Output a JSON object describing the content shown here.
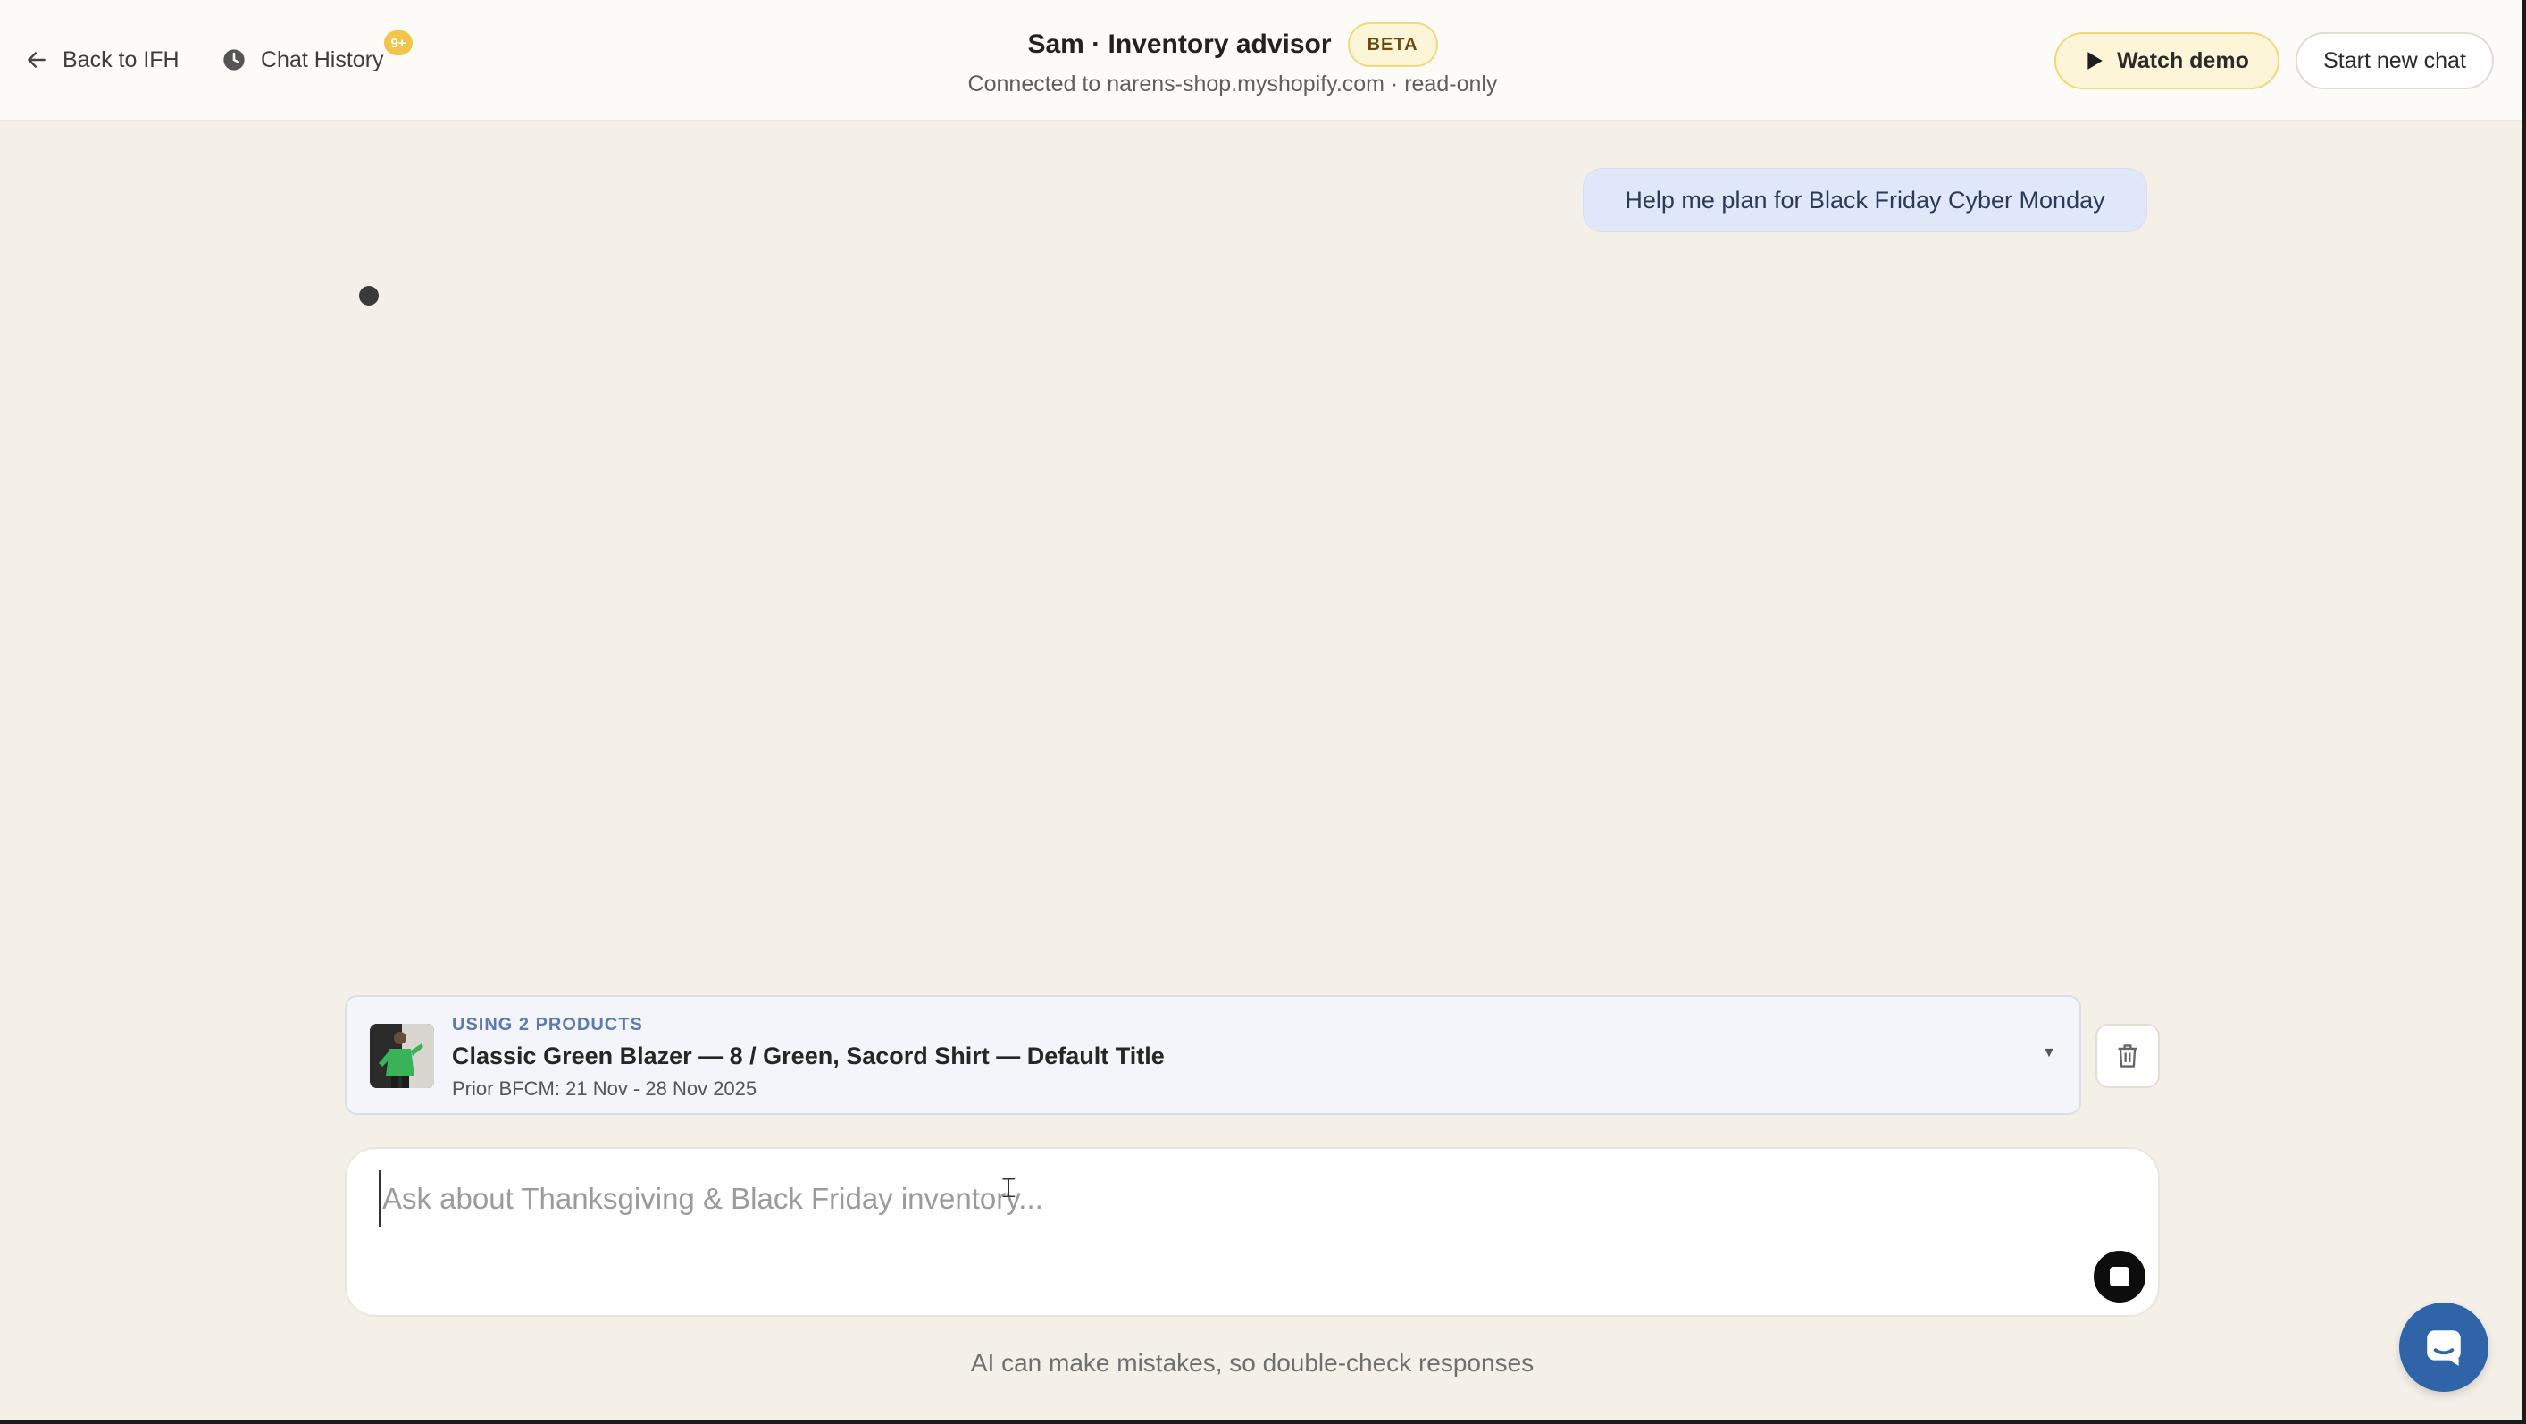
{
  "header": {
    "back_label": "Back to IFH",
    "history_label": "Chat History",
    "history_badge": "9+",
    "title": "Sam · Inventory advisor",
    "beta_badge": "BETA",
    "subtitle": "Connected to narens-shop.myshopify.com · read-only",
    "watch_demo_label": "Watch demo",
    "new_chat_label": "Start new chat"
  },
  "chat": {
    "user_message": "Help me plan for Black Friday Cyber Monday"
  },
  "product_context": {
    "using_label": "USING 2 PRODUCTS",
    "products": "Classic Green Blazer — 8 / Green, Sacord Shirt — Default Title",
    "prior_range": "Prior BFCM: 21 Nov - 28 Nov 2025"
  },
  "composer": {
    "placeholder": "Ask about Thanksgiving & Black Friday inventory...",
    "value": ""
  },
  "footer": {
    "disclaimer": "AI can make mistakes, so double-check responses"
  },
  "colors": {
    "page_bg": "#f4f0e8",
    "accent_blue": "#2f64a8",
    "beta_bg": "#fdf5d8",
    "user_bubble_bg": "#dfe7f8"
  },
  "icons": {
    "back": "arrow-left-icon",
    "history": "clock-icon",
    "play": "play-icon",
    "trash": "trash-icon",
    "stop": "stop-icon",
    "launcher": "chat-bubble-icon"
  }
}
